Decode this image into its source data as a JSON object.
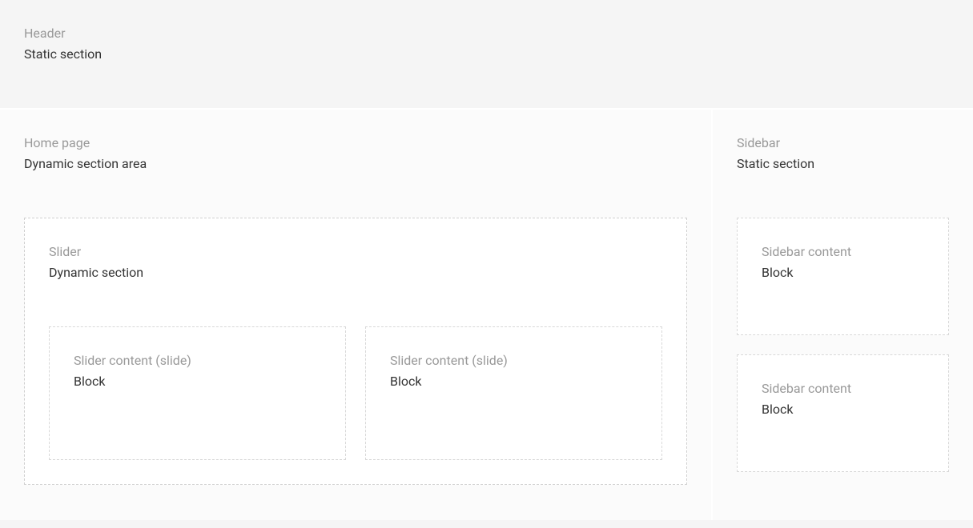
{
  "header": {
    "label": "Header",
    "desc": "Static section"
  },
  "main": {
    "label": "Home page",
    "desc": "Dynamic section area",
    "slider": {
      "label": "Slider",
      "desc": "Dynamic section",
      "slides": [
        {
          "label": "Slider content (slide)",
          "desc": "Block"
        },
        {
          "label": "Slider content (slide)",
          "desc": "Block"
        }
      ]
    }
  },
  "sidebar": {
    "label": "Sidebar",
    "desc": "Static section",
    "blocks": [
      {
        "label": "Sidebar content",
        "desc": "Block"
      },
      {
        "label": "Sidebar content",
        "desc": "Block"
      }
    ]
  }
}
